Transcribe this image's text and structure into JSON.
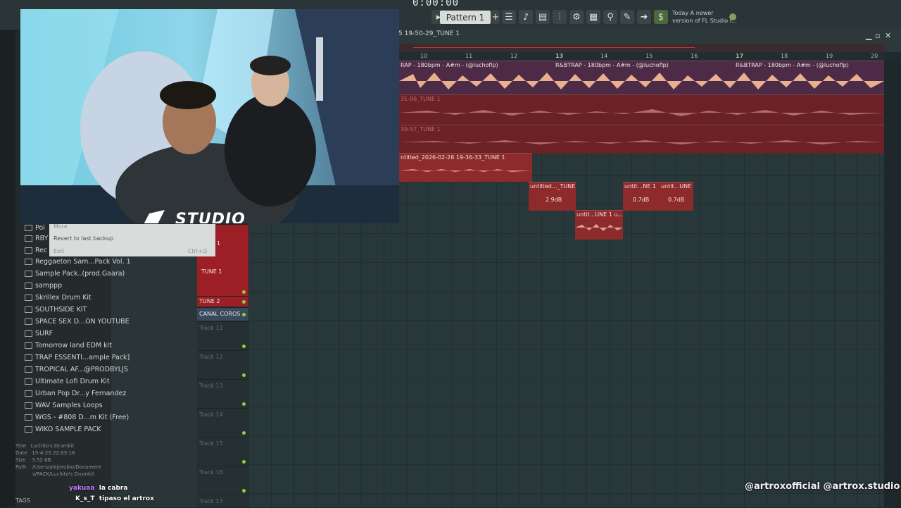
{
  "topbar": {
    "time": "0:00:00",
    "pattern_label": "Pattern 1",
    "news_line1": "Today  A newer",
    "news_line2": "version of FL Studio i..."
  },
  "playlist": {
    "title": "5 19-50-29_TUNE 1",
    "ruler": [
      "10",
      "11",
      "12",
      "13",
      "14",
      "15",
      "16",
      "17",
      "18",
      "19",
      "20"
    ]
  },
  "clips": [
    {
      "label": "RAP - 180bpm - A#m - (@luchoflp)"
    },
    {
      "label": "R&BTRAP - 180bpm - A#m - (@luchoflp)"
    },
    {
      "label": "R&BTRAP - 180bpm - A#m - (@luchoflp)"
    },
    {
      "label": "31-06_TUNE 1"
    },
    {
      "label": "39-57_TUNE 1"
    },
    {
      "label": "ntitled_2026-02-26 19-36-33_TUNE 1"
    },
    {
      "label": "untitled..._TUNE 1",
      "gain": "2.9dB"
    },
    {
      "label": "untit...NE 1",
      "gain": "0.7dB"
    },
    {
      "label": "untit...UNE 1",
      "gain": "0.7dB"
    },
    {
      "label": "untit...UNE 1 u..."
    }
  ],
  "tracks": [
    {
      "label": "1"
    },
    {
      "label": "TUNE 1"
    },
    {
      "label": "TUNE 2"
    },
    {
      "label": "CANAL COROS"
    },
    {
      "label": "Track 11"
    },
    {
      "label": "Track 12"
    },
    {
      "label": "Track 13"
    },
    {
      "label": "Track 14"
    },
    {
      "label": "Track 15"
    },
    {
      "label": "Track 16"
    },
    {
      "label": "Track 17"
    }
  ],
  "browser": {
    "items": [
      "Reggaeton Sam...Pack Vol. 1",
      "Sample Pack..(prod.Gaara)",
      "samppp",
      "Skrillex Drum Kit",
      "SOUTHSIDE KIT",
      "SPACE SEX D...ON YOUTUBE",
      "SURF",
      "Tomorrow land EDM kit",
      "TRAP ESSENTI...ample Pack]",
      "TROPICAL AF...@PRODBYLJS",
      "Ultimate Lofi Drum Kit",
      "Urban Pop Dr...y Fernandez",
      "WAV Samples Loops",
      "WGS - #808 D...m Kit (Free)",
      "WIKO SAMPLE PACK"
    ],
    "partial_top": [
      "Poi",
      "RBY",
      "Rec"
    ],
    "info": {
      "title_label": "Title",
      "title_value": "Luchito's Drumkit",
      "date_label": "Date",
      "date_value": "15-4-25 22:03:18",
      "size_label": "Size",
      "size_value": "3.52 KB",
      "path_label": "Path",
      "path_value": "/Users/alejorubio/Documents/PACK/Luchito's Drumkit"
    },
    "tags_label": "TAGS"
  },
  "menu": {
    "item1": "More",
    "item2": "Revert to last backup",
    "item3": "Exit",
    "shortcut": "Ctrl+Q"
  },
  "overlay": {
    "brand": "STUDIO",
    "chat": [
      {
        "user": "yakuaa",
        "text": "la cabra",
        "color": "#c57bff"
      },
      {
        "user": "K_s_T",
        "text": "tipaso el artrox",
        "color": "#ffffff"
      }
    ],
    "watermark": "@artroxofficial  @artrox.studio"
  },
  "colors": {
    "accent": "#8cd43a",
    "clip_red": "#8d2a2c",
    "clip_purple": "#5a2f4e",
    "wave_orange": "#e8b08f"
  }
}
